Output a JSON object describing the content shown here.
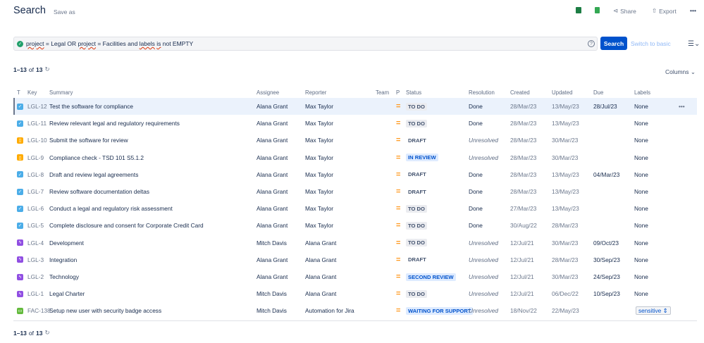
{
  "header": {
    "title": "Search",
    "save_as": "Save as",
    "share": "Share",
    "export": "Export",
    "more": "•••"
  },
  "query": {
    "parts": [
      "project",
      " = Legal OR ",
      "project",
      " = Facilities and ",
      "labels",
      " ",
      "is",
      " not EMPTY"
    ],
    "help": "?",
    "search_label": "Search",
    "switch_label": "Switch to basic"
  },
  "count": {
    "range": "1–13",
    "of": "of",
    "total": "13"
  },
  "columns_button": "Columns",
  "table": {
    "headers": [
      "T",
      "Key",
      "Summary",
      "Assignee",
      "Reporter",
      "Team",
      "P",
      "Status",
      "Resolution",
      "Created",
      "Updated",
      "Due",
      "Labels"
    ],
    "rows": [
      {
        "type": "task",
        "key": "LGL-12",
        "summary": "Test the software for compliance",
        "assignee": "Alana Grant",
        "reporter": "Max Taylor",
        "status": "TO DO",
        "status_style": "todo",
        "resolution": "Done",
        "created": "28/Mar/23",
        "updated": "13/May/23",
        "due": "28/Jul/23",
        "labels": "None",
        "more": "•••"
      },
      {
        "type": "task",
        "key": "LGL-11",
        "summary": "Review relevant legal and regulatory requirements",
        "assignee": "Alana Grant",
        "reporter": "Max Taylor",
        "status": "TO DO",
        "status_style": "todo",
        "resolution": "Done",
        "created": "28/Mar/23",
        "updated": "13/May/23",
        "due": "",
        "labels": "None"
      },
      {
        "type": "document",
        "key": "LGL-10",
        "summary": "Submit the software for review",
        "assignee": "Alana Grant",
        "reporter": "Max Taylor",
        "status": "DRAFT",
        "status_style": "plain",
        "resolution": "Unresolved",
        "created": "28/Mar/23",
        "updated": "30/Mar/23",
        "due": "",
        "labels": "None"
      },
      {
        "type": "document",
        "key": "LGL-9",
        "summary": "Compliance check - TSD 101 S5.1.2",
        "assignee": "Alana Grant",
        "reporter": "Max Taylor",
        "status": "IN REVIEW",
        "status_style": "blue",
        "resolution": "Unresolved",
        "created": "28/Mar/23",
        "updated": "30/Mar/23",
        "due": "",
        "labels": "None"
      },
      {
        "type": "task",
        "key": "LGL-8",
        "summary": "Draft and review legal agreements",
        "assignee": "Alana Grant",
        "reporter": "Max Taylor",
        "status": "DRAFT",
        "status_style": "plain",
        "resolution": "Done",
        "created": "28/Mar/23",
        "updated": "13/May/23",
        "due": "04/Mar/23",
        "labels": "None"
      },
      {
        "type": "task",
        "key": "LGL-7",
        "summary": "Review software documentation deltas",
        "assignee": "Alana Grant",
        "reporter": "Max Taylor",
        "status": "DRAFT",
        "status_style": "plain",
        "resolution": "Done",
        "created": "28/Mar/23",
        "updated": "13/May/23",
        "due": "",
        "labels": "None"
      },
      {
        "type": "task",
        "key": "LGL-6",
        "summary": "Conduct a legal and regulatory risk assessment",
        "assignee": "Alana Grant",
        "reporter": "Max Taylor",
        "status": "TO DO",
        "status_style": "todo",
        "resolution": "Done",
        "created": "27/Mar/23",
        "updated": "13/May/23",
        "due": "",
        "labels": "None"
      },
      {
        "type": "task",
        "key": "LGL-5",
        "summary": "Complete disclosure and consent for Corporate Credit Card",
        "assignee": "Alana Grant",
        "reporter": "Max Taylor",
        "status": "TO DO",
        "status_style": "todo",
        "resolution": "Done",
        "created": "30/Aug/22",
        "updated": "28/Mar/23",
        "due": "",
        "labels": "None"
      },
      {
        "type": "epic",
        "key": "LGL-4",
        "summary": "Development",
        "assignee": "Mitch Davis",
        "reporter": "Alana Grant",
        "status": "TO DO",
        "status_style": "todo",
        "resolution": "Unresolved",
        "created": "12/Jul/21",
        "updated": "30/Mar/23",
        "due": "09/Oct/23",
        "labels": "None"
      },
      {
        "type": "epic",
        "key": "LGL-3",
        "summary": "Integration",
        "assignee": "Alana Grant",
        "reporter": "Alana Grant",
        "status": "DRAFT",
        "status_style": "plain",
        "resolution": "Unresolved",
        "created": "12/Jul/21",
        "updated": "28/Mar/23",
        "due": "30/Sep/23",
        "labels": "None"
      },
      {
        "type": "epic",
        "key": "LGL-2",
        "summary": "Technology",
        "assignee": "Alana Grant",
        "reporter": "Alana Grant",
        "status": "SECOND REVIEW",
        "status_style": "blue",
        "resolution": "Unresolved",
        "created": "12/Jul/21",
        "updated": "30/Mar/23",
        "due": "24/Sep/23",
        "labels": "None"
      },
      {
        "type": "epic",
        "key": "LGL-1",
        "summary": "Legal Charter",
        "assignee": "Mitch Davis",
        "reporter": "Alana Grant",
        "status": "TO DO",
        "status_style": "todo",
        "resolution": "Unresolved",
        "created": "12/Jul/21",
        "updated": "06/Dec/22",
        "due": "10/Sep/23",
        "labels": "None"
      },
      {
        "type": "service-request",
        "key": "FAC-138",
        "summary": "Setup new user with security badge access",
        "assignee": "Mitch Davis",
        "reporter": "Automation for Jira",
        "status": "WAITING FOR SUPPORT",
        "status_style": "blue",
        "resolution": "Unresolved",
        "created": "18/Nov/22",
        "updated": "22/May/23",
        "due": "",
        "labels": "sensitive",
        "labels_style": "tag"
      }
    ]
  },
  "colors": {
    "primary": "#0052cc",
    "task": "#4bade8",
    "document": "#ffab00",
    "epic": "#904ee2",
    "service-request": "#63ba3c",
    "priority_medium": "#ff991f"
  }
}
